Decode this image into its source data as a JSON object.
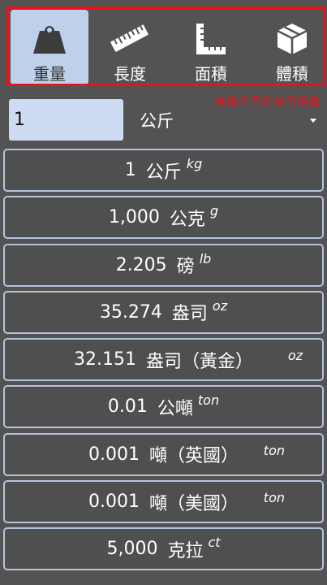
{
  "tabs": [
    {
      "label": "重量",
      "icon": "weight-icon",
      "active": true
    },
    {
      "label": "長度",
      "icon": "ruler-icon",
      "active": false
    },
    {
      "label": "面積",
      "icon": "area-icon",
      "active": false
    },
    {
      "label": "體積",
      "icon": "cube-icon",
      "active": false
    }
  ],
  "annotation": "选择不同的单位换算",
  "input": {
    "value": "1"
  },
  "unit_select": {
    "selected": "公斤"
  },
  "results": [
    {
      "value": "1",
      "name": "公斤",
      "abbr": "kg"
    },
    {
      "value": "1,000",
      "name": "公克",
      "abbr": "g"
    },
    {
      "value": "2.205",
      "name": "磅",
      "abbr": "lb"
    },
    {
      "value": "35.274",
      "name": "盎司",
      "abbr": "oz"
    },
    {
      "value": "32.151",
      "name": "盎司（黃金）",
      "abbr": "oz"
    },
    {
      "value": "0.01",
      "name": "公噸",
      "abbr": "ton"
    },
    {
      "value": "0.001",
      "name": "噸（英國）",
      "abbr": "ton"
    },
    {
      "value": "0.001",
      "name": "噸（美國）",
      "abbr": "ton"
    },
    {
      "value": "5,000",
      "name": "克拉",
      "abbr": "ct"
    }
  ],
  "colors": {
    "background": "#535353",
    "active_tab": "#bfd0ea",
    "row_border": "#b5c3df",
    "annotation": "#e8141a"
  }
}
